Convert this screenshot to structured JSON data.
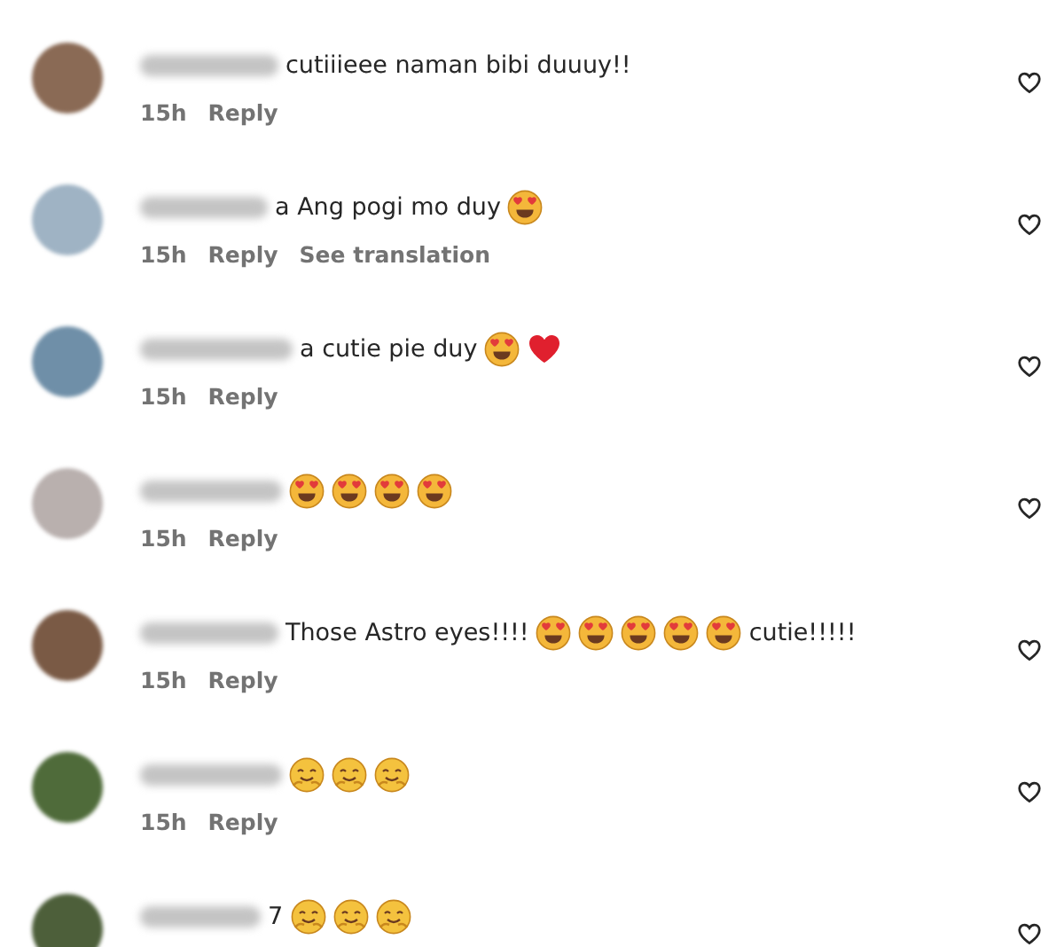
{
  "comments": [
    {
      "body": [
        {
          "kind": "text",
          "text": "cutiiieee naman bibi duuuy!!"
        }
      ],
      "meta": {
        "time": "15h",
        "reply": "Reply"
      }
    },
    {
      "body": [
        {
          "kind": "text",
          "text": "a Ang pogi mo duy"
        },
        {
          "kind": "heart-eyes"
        }
      ],
      "meta": {
        "time": "15h",
        "reply": "Reply",
        "translate": "See translation"
      }
    },
    {
      "body": [
        {
          "kind": "text",
          "text": "a cutie pie duy"
        },
        {
          "kind": "heart-eyes"
        },
        {
          "kind": "red-heart"
        }
      ],
      "meta": {
        "time": "15h",
        "reply": "Reply"
      }
    },
    {
      "body": [
        {
          "kind": "heart-eyes"
        },
        {
          "kind": "heart-eyes"
        },
        {
          "kind": "heart-eyes"
        },
        {
          "kind": "heart-eyes"
        }
      ],
      "meta": {
        "time": "15h",
        "reply": "Reply"
      }
    },
    {
      "body": [
        {
          "kind": "text",
          "text": "Those Astro eyes!!!!"
        },
        {
          "kind": "heart-eyes"
        },
        {
          "kind": "heart-eyes"
        },
        {
          "kind": "heart-eyes"
        },
        {
          "kind": "heart-eyes"
        },
        {
          "kind": "heart-eyes"
        },
        {
          "kind": "text",
          "text": "cutie!!!!!"
        }
      ],
      "meta": {
        "time": "15h",
        "reply": "Reply"
      }
    },
    {
      "body": [
        {
          "kind": "hug"
        },
        {
          "kind": "hug"
        },
        {
          "kind": "hug"
        }
      ],
      "meta": {
        "time": "15h",
        "reply": "Reply"
      }
    },
    {
      "body": [
        {
          "kind": "text",
          "text": "7"
        },
        {
          "kind": "hug"
        },
        {
          "kind": "hug"
        },
        {
          "kind": "hug"
        }
      ]
    }
  ]
}
